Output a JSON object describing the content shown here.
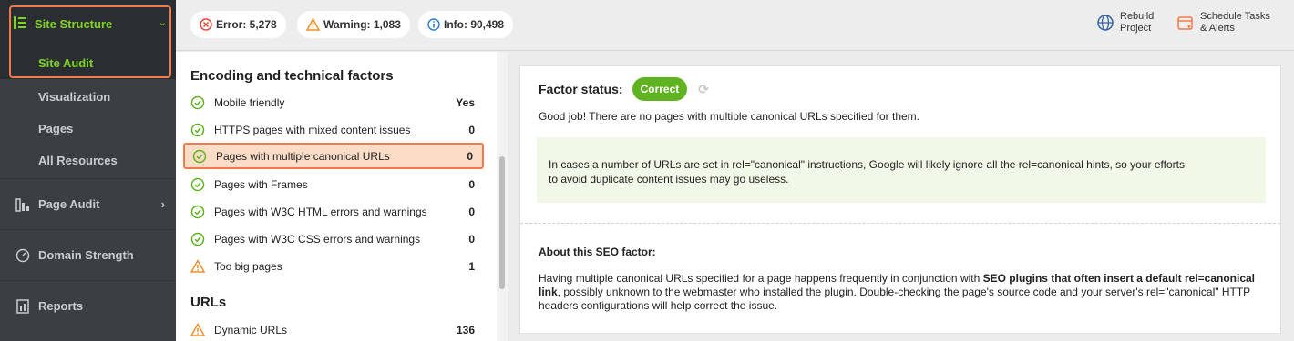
{
  "sidebar": {
    "header_label": "Site Structure",
    "sub_items": [
      {
        "label": "Site Audit",
        "active": true
      },
      {
        "label": "Visualization",
        "active": false
      },
      {
        "label": "Pages",
        "active": false
      },
      {
        "label": "All Resources",
        "active": false
      }
    ],
    "main_items": [
      {
        "label": "Page Audit",
        "icon": "page-audit-icon",
        "has_chevron": true
      },
      {
        "label": "Domain Strength",
        "icon": "gauge-icon",
        "has_chevron": false
      },
      {
        "label": "Reports",
        "icon": "reports-icon",
        "has_chevron": false
      }
    ]
  },
  "topbar": {
    "error_label": "Error: 5,278",
    "warning_label": "Warning: 1,083",
    "info_label": "Info: 90,498",
    "rebuild_line1": "Rebuild",
    "rebuild_line2": "Project",
    "schedule_line1": "Schedule Tasks",
    "schedule_line2": "& Alerts"
  },
  "list": {
    "section1_title": "Encoding and technical factors",
    "section1_rows": [
      {
        "label": "Mobile friendly",
        "value": "Yes",
        "status": "ok"
      },
      {
        "label": "HTTPS pages with mixed content issues",
        "value": "0",
        "status": "ok"
      },
      {
        "label": "Pages with multiple canonical URLs",
        "value": "0",
        "status": "ok",
        "selected": true
      },
      {
        "label": "Pages with Frames",
        "value": "0",
        "status": "ok"
      },
      {
        "label": "Pages with W3C HTML errors and warnings",
        "value": "0",
        "status": "ok"
      },
      {
        "label": "Pages with W3C CSS errors and warnings",
        "value": "0",
        "status": "ok"
      },
      {
        "label": "Too big pages",
        "value": "1",
        "status": "warning"
      }
    ],
    "section2_title": "URLs",
    "section2_rows": [
      {
        "label": "Dynamic URLs",
        "value": "136",
        "status": "warning"
      }
    ]
  },
  "panel": {
    "factor_status_label": "Factor status:",
    "status_badge": "Correct",
    "message": "Good job! There are no pages with multiple canonical URLs specified for them.",
    "note_line1": "In cases a number of URLs are set in rel=\"canonical\" instructions, Google will likely ignore all the rel=canonical hints, so your efforts",
    "note_line2": "to avoid duplicate content issues may go useless.",
    "about_heading": "About this SEO factor:",
    "about_pre": "Having multiple canonical URLs specified for a page happens frequently in conjunction with ",
    "about_bold": "SEO plugins that often insert a default rel=canonical link",
    "about_post": ", possibly unknown to the webmaster who installed the plugin. Double-checking the page's source code and your server's rel=\"canonical\" HTTP headers configurations will help correct the issue."
  },
  "colors": {
    "accent_green": "#7ed320",
    "highlight_orange": "#f07a4a",
    "error_red": "#e04a3c",
    "warning_orange": "#f0902c",
    "info_blue": "#2f7fd8",
    "ok_green": "#5fb320"
  }
}
